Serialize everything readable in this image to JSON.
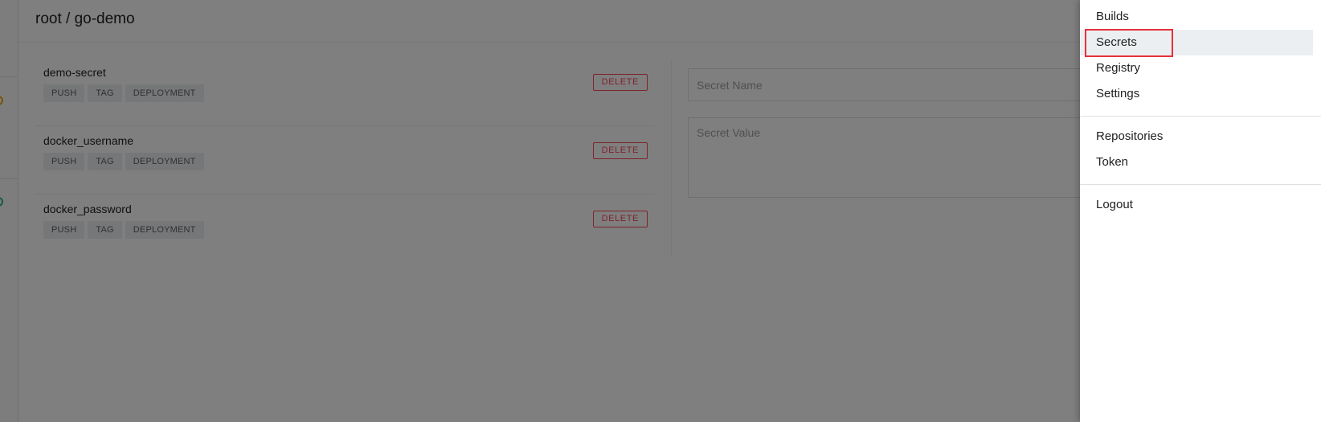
{
  "header": {
    "title": "root / go-demo"
  },
  "rail": {
    "status_colors": [
      "#f0a500",
      "#29b286"
    ]
  },
  "secrets": [
    {
      "name": "demo-secret",
      "events": [
        "PUSH",
        "TAG",
        "DEPLOYMENT"
      ],
      "delete_label": "DELETE"
    },
    {
      "name": "docker_username",
      "events": [
        "PUSH",
        "TAG",
        "DEPLOYMENT"
      ],
      "delete_label": "DELETE"
    },
    {
      "name": "docker_password",
      "events": [
        "PUSH",
        "TAG",
        "DEPLOYMENT"
      ],
      "delete_label": "DELETE"
    }
  ],
  "form": {
    "name_placeholder": "Secret Name",
    "value_placeholder": "Secret Value"
  },
  "menu": {
    "items": [
      {
        "label": "Builds"
      },
      {
        "label": "Secrets",
        "active": true
      },
      {
        "label": "Registry"
      },
      {
        "label": "Settings"
      }
    ],
    "account_items": [
      {
        "label": "Repositories"
      },
      {
        "label": "Token"
      }
    ],
    "logout_label": "Logout"
  },
  "colors": {
    "delete": "#fc4758",
    "highlight": "#e5323c",
    "tag_bg": "#eceff1"
  }
}
